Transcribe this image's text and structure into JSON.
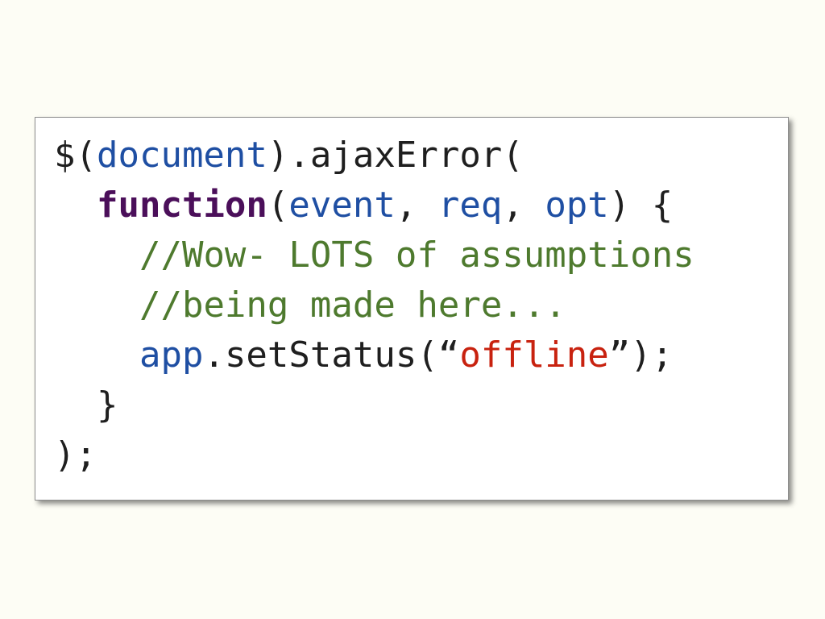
{
  "code": {
    "line1": {
      "p1": "$(",
      "document": "document",
      "p2": ").ajaxError("
    },
    "line2": {
      "indent": "  ",
      "keyword": "function",
      "p1": "(",
      "event": "event",
      "p2": ", ",
      "req": "req",
      "p3": ", ",
      "opt": "opt",
      "p4": ") {"
    },
    "line3": {
      "indent": "    ",
      "comment": "//Wow- LOTS of assumptions"
    },
    "line4": {
      "indent": "    ",
      "comment": "//being made here..."
    },
    "line5": {
      "indent": "    ",
      "app": "app",
      "p1": ".setStatus(“",
      "string": "offline",
      "p2": "”);"
    },
    "line6": {
      "indent": "  ",
      "text": "}"
    },
    "line7": {
      "text": ");"
    }
  },
  "colors": {
    "background": "#fdfdf5",
    "identifier": "#1f4fa3",
    "keyword": "#4b0f5a",
    "comment": "#4e7a2e",
    "string": "#c8220f",
    "text": "#1f1f1f"
  }
}
